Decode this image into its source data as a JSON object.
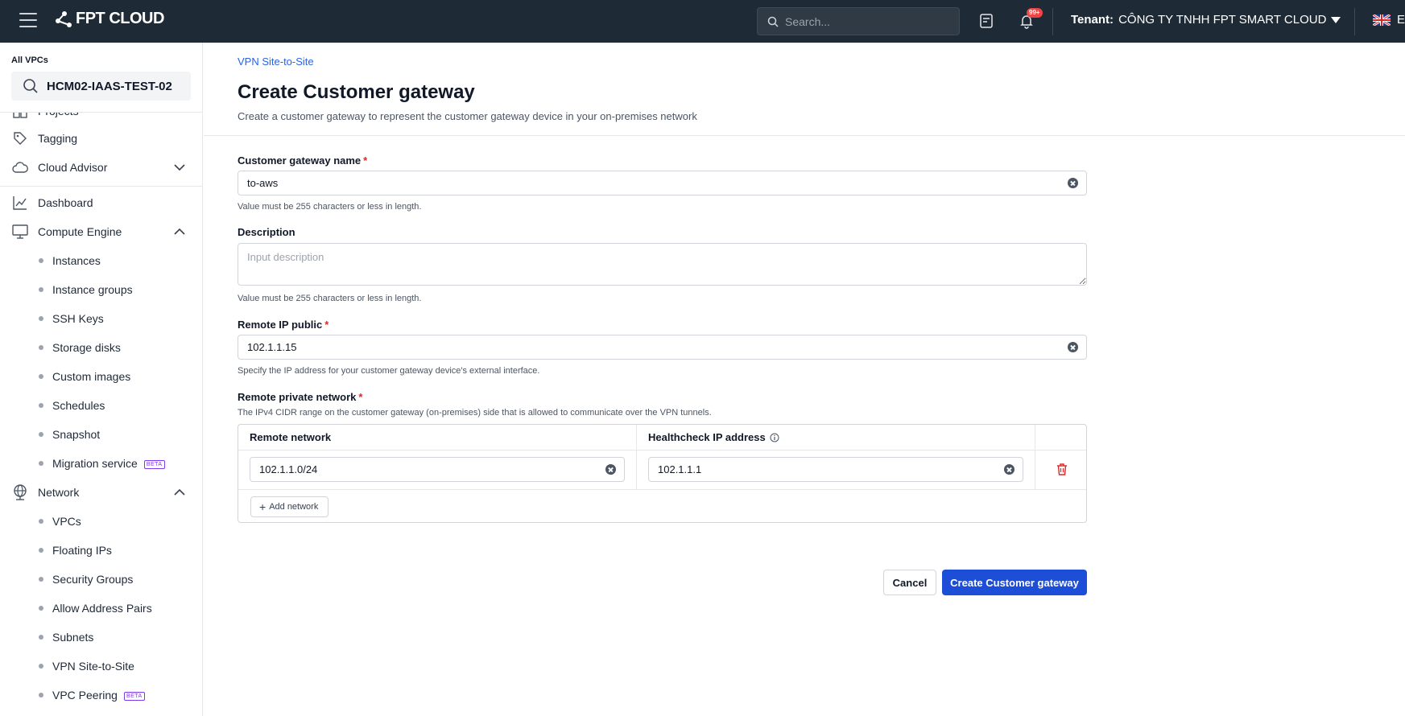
{
  "topbar": {
    "brand": "FPT CLOUD",
    "search_placeholder": "Search...",
    "notification_count": "99+",
    "tenant_label": "Tenant:",
    "tenant_name": "CÔNG TY TNHH FPT SMART CLOUD",
    "language": "En"
  },
  "sidebar": {
    "vpc_label": "All VPCs",
    "vpc_selected": "HCM02-IAAS-TEST-02",
    "items": [
      {
        "label": "Projects"
      },
      {
        "label": "Tagging"
      },
      {
        "label": "Cloud Advisor"
      },
      {
        "label": "Dashboard"
      },
      {
        "label": "Compute Engine"
      },
      {
        "label": "Network"
      }
    ],
    "compute_sub": [
      {
        "label": "Instances"
      },
      {
        "label": "Instance groups"
      },
      {
        "label": "SSH Keys"
      },
      {
        "label": "Storage disks"
      },
      {
        "label": "Custom images"
      },
      {
        "label": "Schedules"
      },
      {
        "label": "Snapshot"
      },
      {
        "label": "Migration service",
        "badge": "BETA"
      }
    ],
    "network_sub": [
      {
        "label": "VPCs"
      },
      {
        "label": "Floating IPs"
      },
      {
        "label": "Security Groups"
      },
      {
        "label": "Allow Address Pairs"
      },
      {
        "label": "Subnets"
      },
      {
        "label": "VPN Site-to-Site"
      },
      {
        "label": "VPC Peering",
        "badge": "BETA"
      }
    ]
  },
  "main": {
    "breadcrumb": "VPN Site-to-Site",
    "title": "Create Customer gateway",
    "subtitle": "Create a customer gateway to represent the customer gateway device in your on-premises network",
    "fields": {
      "name_label": "Customer gateway name",
      "name_value": "to-aws",
      "name_hint": "Value must be 255 characters or less in length.",
      "desc_label": "Description",
      "desc_placeholder": "Input description",
      "desc_hint": "Value must be 255 characters or less in length.",
      "ip_label": "Remote IP public",
      "ip_value": "102.1.1.15",
      "ip_hint": "Specify the IP address for your customer gateway device's external interface.",
      "network_label": "Remote private network",
      "network_hint": "The IPv4 CIDR range on the customer gateway (on-premises) side that is allowed to communicate over the VPN tunnels."
    },
    "network_table": {
      "col_remote": "Remote network",
      "col_health": "Healthcheck IP address",
      "rows": [
        {
          "remote": "102.1.1.0/24",
          "health": "102.1.1.1"
        }
      ],
      "add_label": "Add network"
    },
    "actions": {
      "cancel": "Cancel",
      "create": "Create Customer gateway"
    }
  }
}
